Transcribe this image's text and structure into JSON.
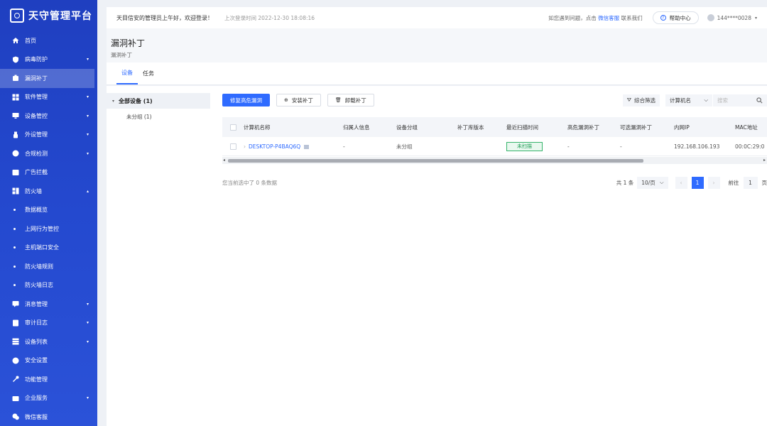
{
  "app": {
    "name": "天守管理平台"
  },
  "sidebar": {
    "items": [
      {
        "label": "首页",
        "icon": "home-icon"
      },
      {
        "label": "病毒防护",
        "icon": "shield-icon",
        "caret": "▾"
      },
      {
        "label": "漏洞补丁",
        "icon": "patch-icon",
        "active": true
      },
      {
        "label": "软件管理",
        "icon": "apps-icon",
        "caret": "▾"
      },
      {
        "label": "设备管控",
        "icon": "monitor-icon",
        "caret": "▾"
      },
      {
        "label": "外设管理",
        "icon": "usb-icon",
        "caret": "▾"
      },
      {
        "label": "合规检测",
        "icon": "compliance-icon",
        "caret": "▾"
      },
      {
        "label": "广告拦截",
        "icon": "ad-block-icon"
      },
      {
        "label": "防火墙",
        "icon": "firewall-icon",
        "caret": "▴"
      },
      {
        "label": "数据概览",
        "sub": true
      },
      {
        "label": "上网行为管控",
        "sub": true
      },
      {
        "label": "主机端口安全",
        "sub": true
      },
      {
        "label": "防火墙规则",
        "sub": true
      },
      {
        "label": "防火墙日志",
        "sub": true
      },
      {
        "label": "消息管理",
        "icon": "message-icon",
        "caret": "▾"
      },
      {
        "label": "审计日志",
        "icon": "audit-log-icon",
        "caret": "▾"
      },
      {
        "label": "设备列表",
        "icon": "device-list-icon",
        "caret": "▾"
      },
      {
        "label": "安全设置",
        "icon": "security-settings-icon"
      },
      {
        "label": "功能管理",
        "icon": "tools-icon"
      },
      {
        "label": "企业服务",
        "icon": "service-icon",
        "caret": "▾"
      },
      {
        "label": "微信客服",
        "icon": "wechat-icon"
      }
    ]
  },
  "header": {
    "welcome": "天目信安的管理员上午好，欢迎登录！",
    "last_login": "上次登录时间 2022-12-30 18:08:16",
    "help_prefix": "如您遇到问题，点击",
    "help_link": "微信客服",
    "help_suffix": "联系我们",
    "help_center": "帮助中心",
    "user": "144****0028"
  },
  "page": {
    "title": "漏洞补丁",
    "breadcrumb": "漏洞补丁"
  },
  "tabs": [
    {
      "label": "设备"
    },
    {
      "label": "任务"
    }
  ],
  "tree": {
    "root": "全部设备 (1)",
    "child": "未分组 (1)"
  },
  "toolbar": {
    "fix_btn": "修复高危漏洞",
    "install_btn": "安装补丁",
    "uninstall_btn": "卸载补丁",
    "filter_btn": "综合筛选",
    "select_value": "计算机名",
    "search_placeholder": "搜索"
  },
  "table": {
    "columns": [
      "计算机名称",
      "归属人信息",
      "设备分组",
      "补丁库版本",
      "最近扫描时间",
      "高危漏洞补丁",
      "可选漏洞补丁",
      "内网IP",
      "MAC地址"
    ],
    "rows": [
      {
        "name": "DESKTOP-P4BAQ6Q",
        "owner": "-",
        "group": "未分组",
        "patch_version": "",
        "last_scan": "未扫描",
        "high_risk": "-",
        "optional": "-",
        "ip": "192.168.106.193",
        "mac": "00:0C:29:0"
      }
    ]
  },
  "footer": {
    "selected_info": "您当前选中了 0 条数据",
    "total": "共 1 条",
    "page_size": "10/页",
    "current_page": "1",
    "goto_label": "前往",
    "goto_value": "1",
    "page_unit": "页"
  },
  "colors": {
    "primary": "#2f6bff",
    "sidebar": "#2449cf",
    "success": "#35b46b"
  }
}
